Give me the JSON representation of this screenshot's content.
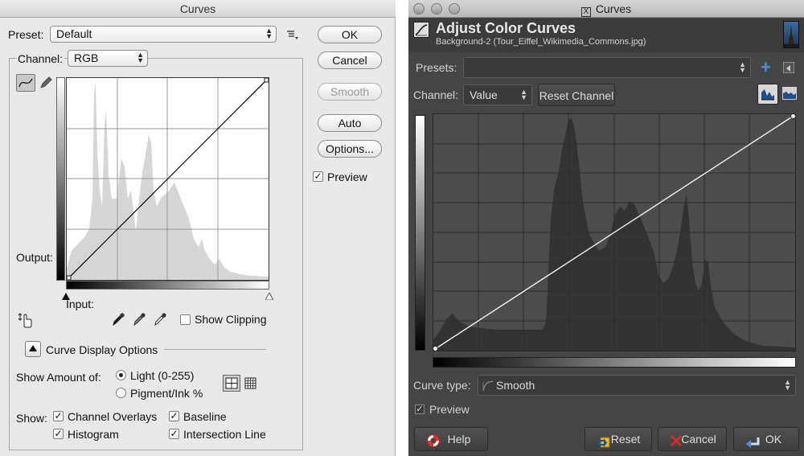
{
  "photoshop": {
    "title": "Curves",
    "preset": {
      "label": "Preset:",
      "value": "Default"
    },
    "channel": {
      "label": "Channel:",
      "value": "RGB"
    },
    "buttons": {
      "ok": "OK",
      "cancel": "Cancel",
      "smooth": "Smooth",
      "auto": "Auto",
      "options": "Options..."
    },
    "preview": {
      "label": "Preview",
      "checked": true
    },
    "output_label": "Output:",
    "input_label": "Input:",
    "show_clipping": {
      "label": "Show Clipping",
      "checked": false
    },
    "curve_display_options": "Curve Display Options",
    "show_amount_of": {
      "label": "Show Amount of:",
      "light": "Light  (0-255)",
      "pigment": "Pigment/Ink %",
      "selected": "light"
    },
    "show": {
      "label": "Show:",
      "channel_overlays": "Channel Overlays",
      "baseline": "Baseline",
      "histogram": "Histogram",
      "intersection_line": "Intersection Line"
    }
  },
  "gimp": {
    "window_title": "Curves",
    "heading": "Adjust Color Curves",
    "subheading": "Background-2 (Tour_Eiffel_Wikimedia_Commons.jpg)",
    "presets": {
      "label": "Presets:",
      "value": ""
    },
    "channel": {
      "label": "Channel:",
      "value": "Value"
    },
    "reset_channel": "Reset Channel",
    "curve_type": {
      "label": "Curve type:",
      "value": "Smooth"
    },
    "preview": {
      "label": "Preview",
      "checked": true
    },
    "buttons": {
      "help": "Help",
      "reset": "Reset",
      "cancel": "Cancel",
      "ok": "OK"
    }
  },
  "colors": {
    "ps_bg": "#e8e8e8",
    "gimp_bg": "#454545",
    "gimp_accent": "#4a90d9",
    "help_icon": "#d9342b",
    "cancel_icon": "#d42a2a"
  }
}
